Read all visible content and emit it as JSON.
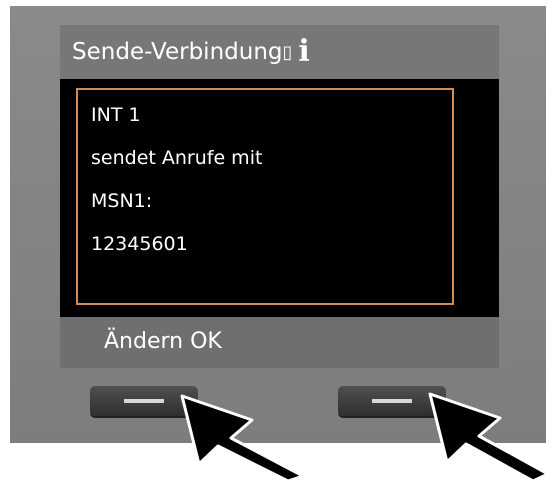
{
  "display": {
    "title": "Sende-Verbindung",
    "title_cursor": "▯",
    "info_icon": "info-icon",
    "lines": [
      "INT 1",
      "sendet Anrufe mit",
      "MSN1:",
      "12345601"
    ],
    "softkeys": "Ändern OK",
    "colors": {
      "bezel": "#7d7d7d",
      "title_bar": "#777777",
      "screen": "#000000",
      "content_border": "#d38a55",
      "softkey_bar": "#6f6f6f",
      "text": "#ffffff"
    }
  },
  "hardware": {
    "left_key_icon": "dash-icon",
    "right_key_icon": "dash-icon",
    "pointer_icons": [
      "arrow-pointer-icon",
      "arrow-pointer-icon"
    ]
  }
}
